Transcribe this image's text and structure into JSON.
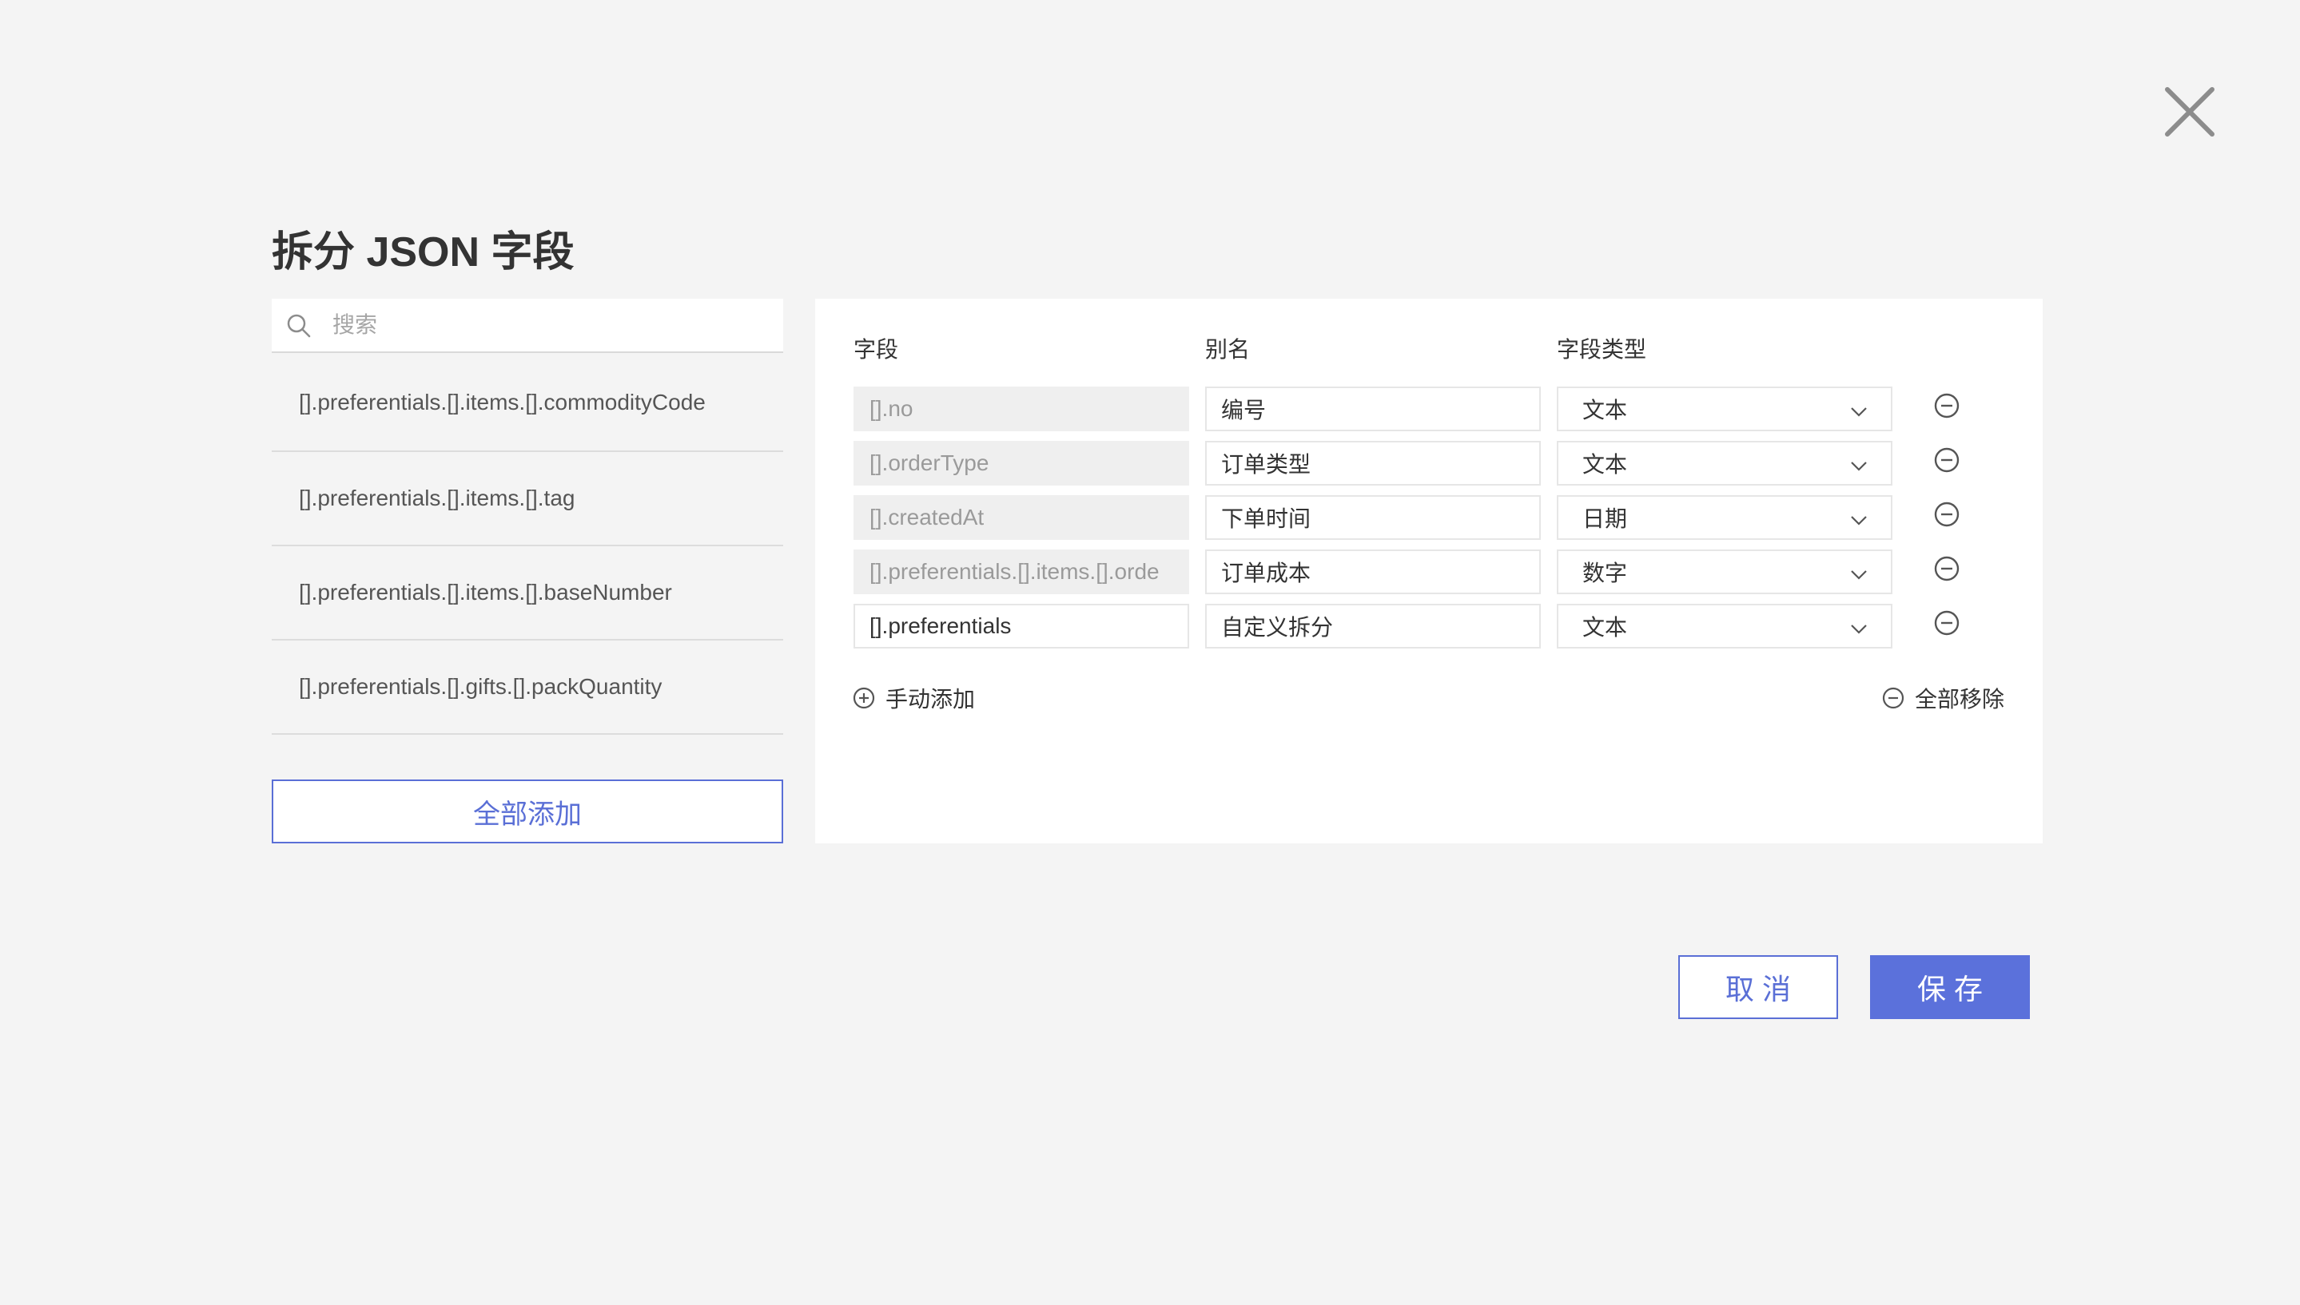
{
  "dialog": {
    "title": "拆分 JSON 字段",
    "close_icon": "close-icon"
  },
  "search": {
    "placeholder": "搜索",
    "value": ""
  },
  "available_fields": [
    "[].preferentials.[].items.[].commodityCode",
    "[].preferentials.[].items.[].tag",
    "[].preferentials.[].items.[].baseNumber",
    "[].preferentials.[].gifts.[].packQuantity"
  ],
  "add_all_label": "全部添加",
  "table": {
    "headers": {
      "field": "字段",
      "alias": "别名",
      "type": "字段类型"
    },
    "rows": [
      {
        "field": "[].no",
        "alias": "编号",
        "type": "文本",
        "field_editable": false
      },
      {
        "field": "[].orderType",
        "alias": "订单类型",
        "type": "文本",
        "field_editable": false
      },
      {
        "field": "[].createdAt",
        "alias": "下单时间",
        "type": "日期",
        "field_editable": false
      },
      {
        "field": "[].preferentials.[].items.[].orde",
        "alias": "订单成本",
        "type": "数字",
        "field_editable": false
      },
      {
        "field": "[].preferentials",
        "alias": "自定义拆分",
        "type": "文本",
        "field_editable": true
      }
    ],
    "manual_add_label": "手动添加",
    "remove_all_label": "全部移除"
  },
  "footer": {
    "cancel_label": "取 消",
    "save_label": "保 存"
  },
  "colors": {
    "accent": "#5b71db",
    "background": "#f4f4f4",
    "readonly_field_bg": "#efefef"
  }
}
